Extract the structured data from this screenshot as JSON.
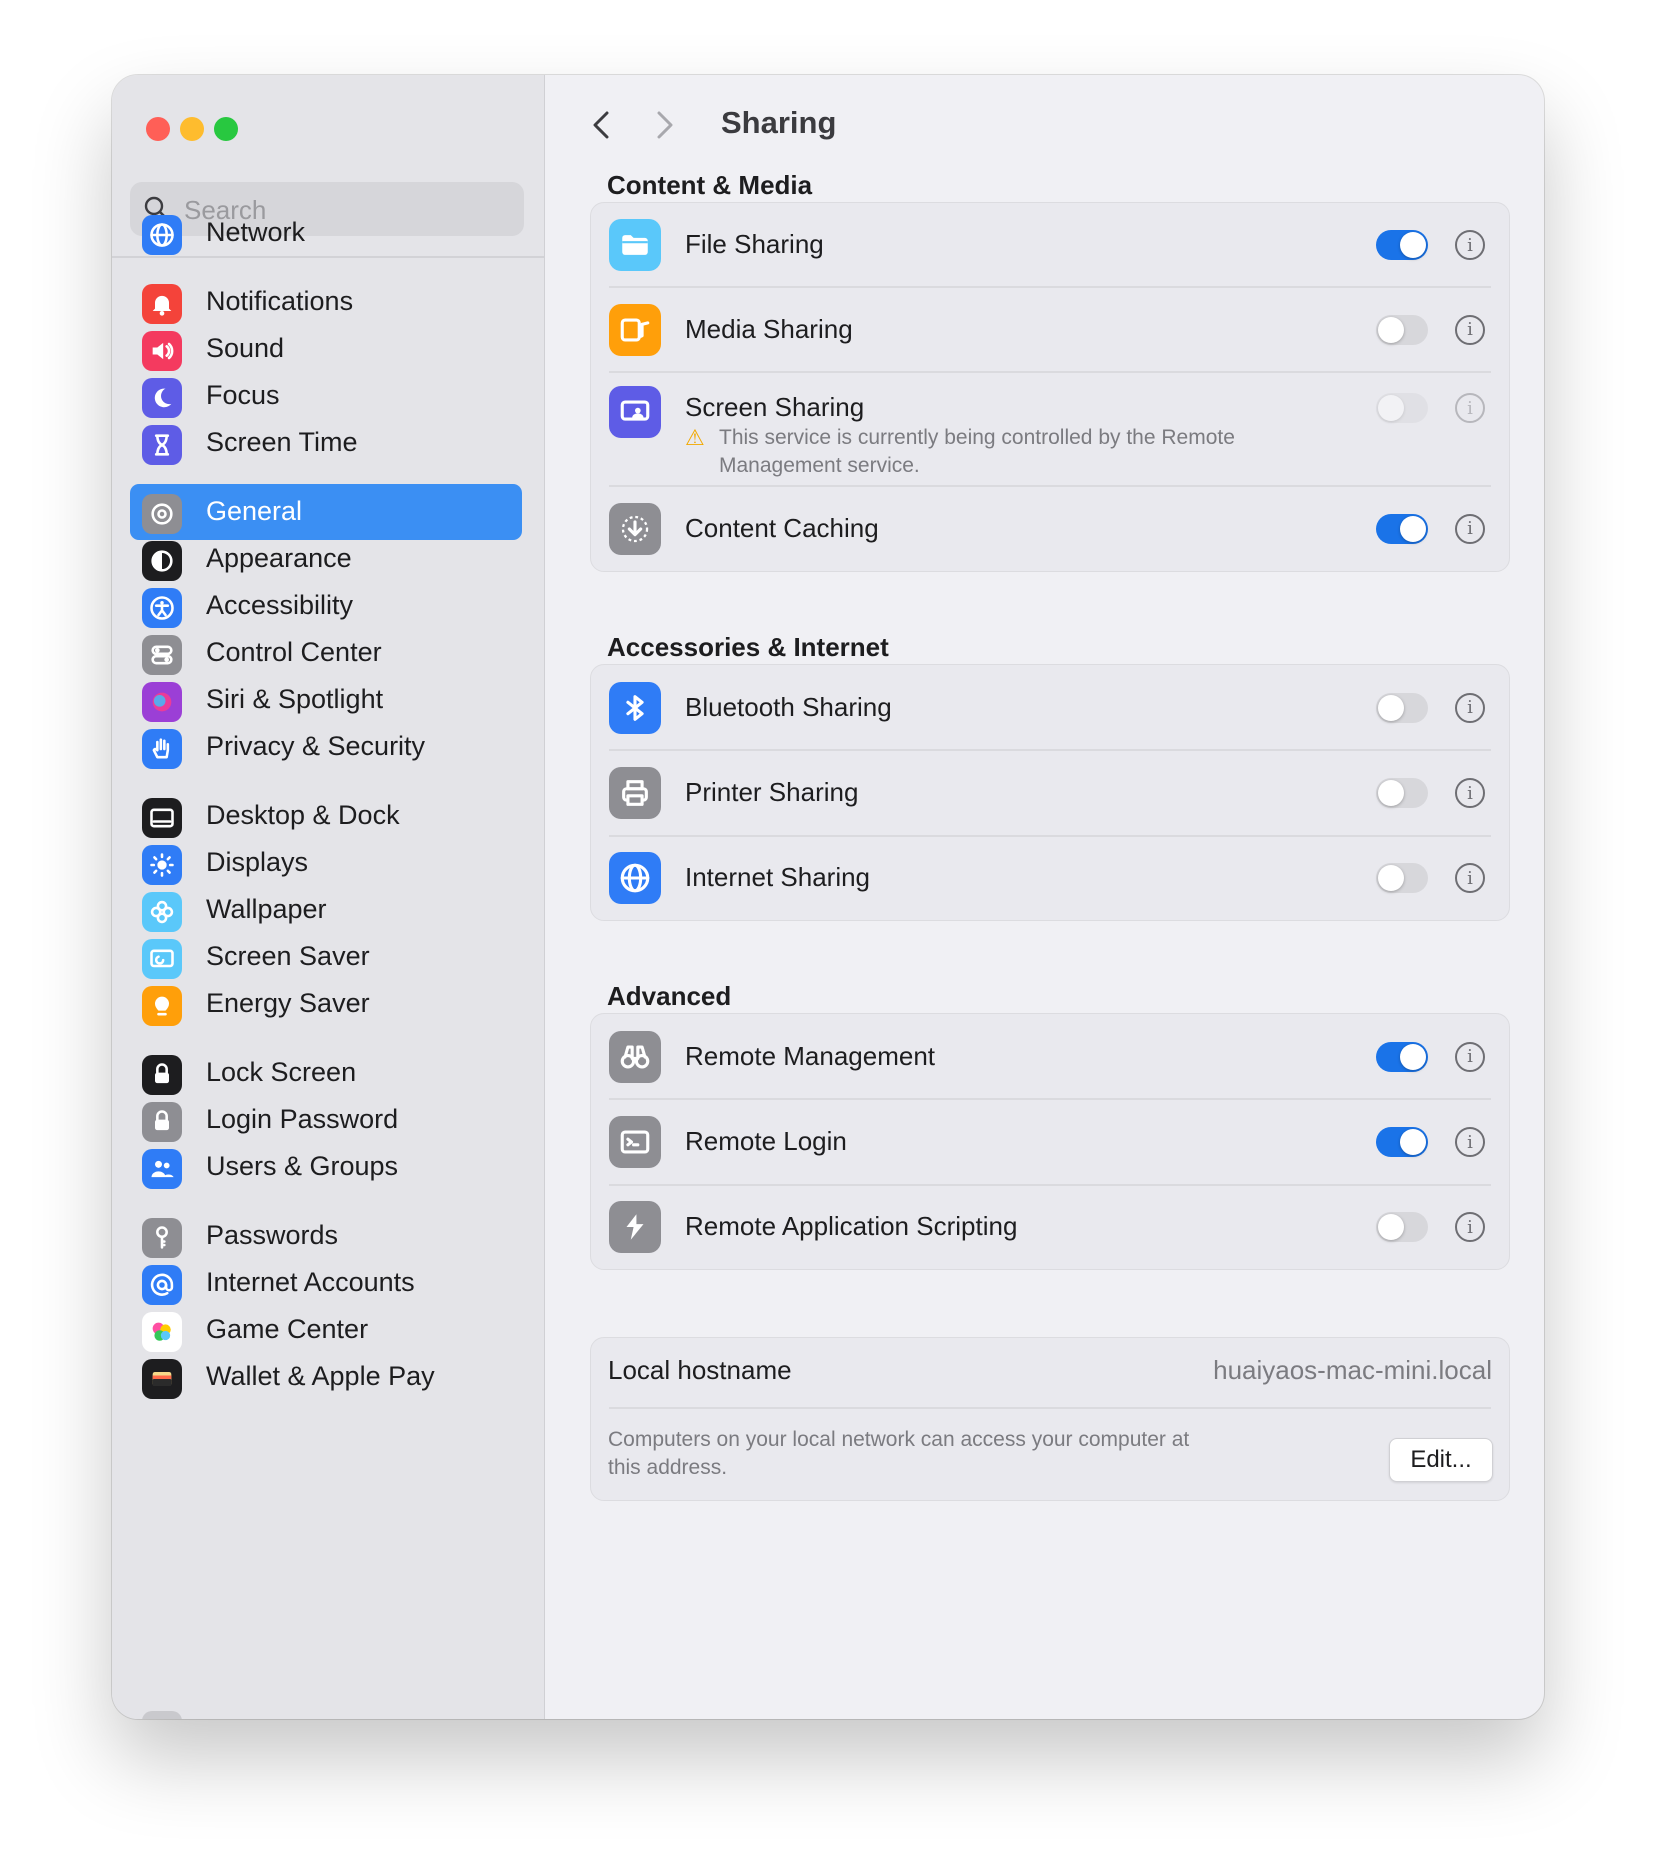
{
  "window": {
    "traffic_lights": {
      "close_color": "#ff5f57",
      "minimize_color": "#febc2e",
      "zoom_color": "#28c840"
    }
  },
  "sidebar": {
    "search_placeholder": "Search",
    "items": [
      {
        "label": "Network",
        "icon": "globe-icon",
        "color": "#2f7cf6"
      },
      {
        "label": "Notifications",
        "icon": "bell-icon",
        "color": "#f4433a"
      },
      {
        "label": "Sound",
        "icon": "speaker-icon",
        "color": "#f43a5f"
      },
      {
        "label": "Focus",
        "icon": "moon-icon",
        "color": "#5e5ce6"
      },
      {
        "label": "Screen Time",
        "icon": "hourglass-icon",
        "color": "#5e5ce6"
      },
      {
        "label": "General",
        "icon": "gear-icon",
        "color": "#8e8e93",
        "selected": true
      },
      {
        "label": "Appearance",
        "icon": "appearance-icon",
        "color": "#1d1d1f"
      },
      {
        "label": "Accessibility",
        "icon": "accessibility-icon",
        "color": "#2f7cf6"
      },
      {
        "label": "Control Center",
        "icon": "switches-icon",
        "color": "#8e8e93"
      },
      {
        "label": "Siri & Spotlight",
        "icon": "siri-icon",
        "color": "#9b3fd6"
      },
      {
        "label": "Privacy & Security",
        "icon": "hand-icon",
        "color": "#2f7cf6"
      },
      {
        "label": "Desktop & Dock",
        "icon": "dock-icon",
        "color": "#1d1d1f"
      },
      {
        "label": "Displays",
        "icon": "sun-icon",
        "color": "#2f7cf6"
      },
      {
        "label": "Wallpaper",
        "icon": "flower-icon",
        "color": "#5ac8fa"
      },
      {
        "label": "Screen Saver",
        "icon": "screensaver-icon",
        "color": "#5ac8fa"
      },
      {
        "label": "Energy Saver",
        "icon": "lightbulb-icon",
        "color": "#ff9f0a"
      },
      {
        "label": "Lock Screen",
        "icon": "lock-screen-icon",
        "color": "#1d1d1f"
      },
      {
        "label": "Login Password",
        "icon": "lock-icon",
        "color": "#8e8e93"
      },
      {
        "label": "Users & Groups",
        "icon": "users-icon",
        "color": "#2f7cf6"
      },
      {
        "label": "Passwords",
        "icon": "key-icon",
        "color": "#8e8e93"
      },
      {
        "label": "Internet Accounts",
        "icon": "at-icon",
        "color": "#2f7cf6"
      },
      {
        "label": "Game Center",
        "icon": "game-center-icon",
        "color": "#ffffff"
      },
      {
        "label": "Wallet & Apple Pay",
        "icon": "wallet-icon",
        "color": "#1d1d1f"
      }
    ]
  },
  "header": {
    "title": "Sharing"
  },
  "sections": [
    {
      "title": "Content & Media",
      "rows": [
        {
          "label": "File Sharing",
          "icon": "folder-icon",
          "color": "#5ac8fa",
          "enabled": true
        },
        {
          "label": "Media Sharing",
          "icon": "media-icon",
          "color": "#ff9f0a",
          "enabled": false
        },
        {
          "label": "Screen Sharing",
          "icon": "screen-sharing-icon",
          "color": "#5e5ce6",
          "enabled": false,
          "disabled": true,
          "note": "This service is currently being controlled by the Remote Management service."
        },
        {
          "label": "Content Caching",
          "icon": "download-icon",
          "color": "#8e8e93",
          "enabled": true
        }
      ]
    },
    {
      "title": "Accessories & Internet",
      "rows": [
        {
          "label": "Bluetooth Sharing",
          "icon": "bluetooth-icon",
          "color": "#2f7cf6",
          "enabled": false
        },
        {
          "label": "Printer Sharing",
          "icon": "printer-icon",
          "color": "#8e8e93",
          "enabled": false
        },
        {
          "label": "Internet Sharing",
          "icon": "globe-icon",
          "color": "#2f7cf6",
          "enabled": false
        }
      ]
    },
    {
      "title": "Advanced",
      "rows": [
        {
          "label": "Remote Management",
          "icon": "binoculars-icon",
          "color": "#8e8e93",
          "enabled": true
        },
        {
          "label": "Remote Login",
          "icon": "terminal-icon",
          "color": "#8e8e93",
          "enabled": true
        },
        {
          "label": "Remote Application Scripting",
          "icon": "script-icon",
          "color": "#8e8e93",
          "enabled": false
        }
      ]
    }
  ],
  "hostname": {
    "label": "Local hostname",
    "value": "huaiyaos-mac-mini.local",
    "description": "Computers on your local network can access your computer at this address.",
    "edit_label": "Edit..."
  },
  "info_glyph": "i",
  "warning_glyph": "⚠"
}
